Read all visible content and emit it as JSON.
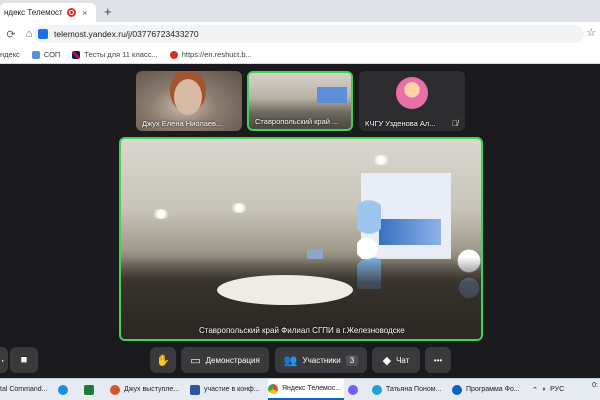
{
  "browser": {
    "tab_title": "ндекс Телемост — беспл",
    "tab_close_icon": "×",
    "new_tab_icon": "+",
    "url": "telemost.yandex.ru/j/03776723433270",
    "bookmarks": [
      {
        "label": "ндекс",
        "icon": "yandex-icon",
        "color": "#e0e0e0"
      },
      {
        "label": "СОП",
        "icon": "sop-icon",
        "color": "#5b8fd8"
      },
      {
        "label": "Тесты для 11 класс...",
        "icon": "uk-flag-icon",
        "color": "#c8102e"
      },
      {
        "label": "https://en.reshuct.b...",
        "icon": "reshu-icon",
        "color": "#d93025"
      }
    ]
  },
  "call": {
    "tiles": [
      {
        "name": "Джух Елена Ниолаев..."
      },
      {
        "name": "Ставропольский край ..."
      },
      {
        "name": "КЧГУ Узденова Ал..."
      }
    ],
    "main_label": "Ставропольский край Филиал СГПИ в г.Железноводске",
    "accent_color": "#45d157"
  },
  "controls": {
    "hand_icon": "✋",
    "demo_label": "Демонстрация",
    "participants_label": "Участники",
    "participants_count": "3",
    "chat_label": "Чат",
    "more_icon": "•••"
  },
  "taskbar": {
    "items": [
      {
        "label": "tal Command...",
        "color": "#4a72c4"
      },
      {
        "label": "",
        "color": "#1d8fe0"
      },
      {
        "label": "",
        "color": "#1f7a3d"
      },
      {
        "label": "Джух выступле...",
        "color": "#d35230"
      },
      {
        "label": "участие в конф...",
        "color": "#2b579a"
      },
      {
        "label": "Яндекс Телемос...",
        "color": "#e8b400"
      },
      {
        "label": "",
        "color": "#7360f2"
      },
      {
        "label": "Татьяна Поном...",
        "color": "#229ed9"
      },
      {
        "label": "Программа Фо...",
        "color": "#0a64c8"
      }
    ],
    "lang": "РУС",
    "clock_tail": "0:"
  }
}
